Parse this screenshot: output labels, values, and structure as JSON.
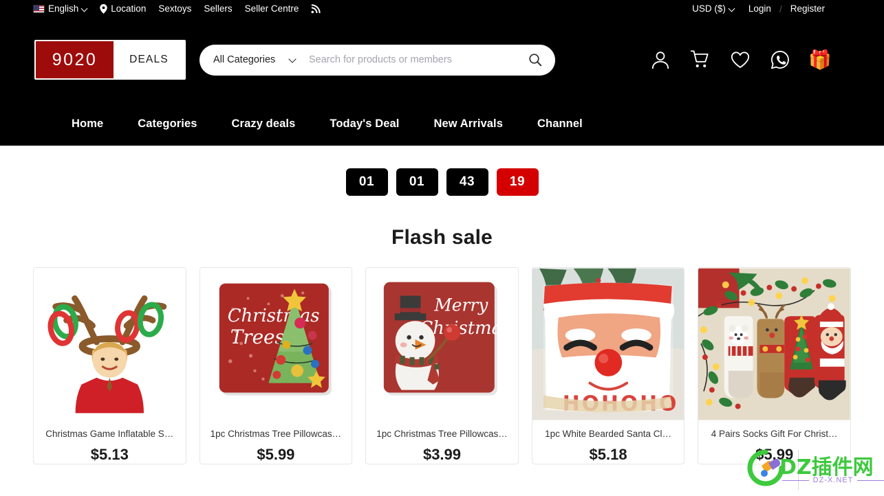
{
  "topbar": {
    "language": "English",
    "language_flag_icon": "us-flag-icon",
    "links": [
      "Location",
      "Sextoys",
      "Sellers",
      "Seller Centre"
    ],
    "rss_icon": "rss-icon",
    "currency": "USD ($)",
    "login": "Login",
    "separator": "/",
    "register": "Register"
  },
  "header": {
    "logo_primary": "9020",
    "logo_secondary": "DEALS",
    "search": {
      "category_label": "All Categories",
      "placeholder": "Search for products or members",
      "value": "",
      "search_icon": "search-icon"
    },
    "icons": [
      {
        "name": "account-icon",
        "label": "Account"
      },
      {
        "name": "cart-icon",
        "label": "Cart"
      },
      {
        "name": "wishlist-heart-icon",
        "label": "Wishlist"
      },
      {
        "name": "whatsapp-icon",
        "label": "WhatsApp"
      },
      {
        "name": "gift-icon",
        "label": "Gift",
        "glyph": "🎁"
      }
    ]
  },
  "nav": {
    "items": [
      "Home",
      "Categories",
      "Crazy deals",
      "Today's Deal",
      "New Arrivals",
      "Channel"
    ]
  },
  "flash_sale": {
    "title": "Flash sale",
    "countdown": [
      {
        "value": "01",
        "accent": false
      },
      {
        "value": "01",
        "accent": false
      },
      {
        "value": "43",
        "accent": false
      },
      {
        "value": "19",
        "accent": true
      }
    ],
    "accent_color": "#d40000"
  },
  "products": [
    {
      "title": "Christmas Game Inflatable S…",
      "price": "$5.13",
      "image": "reindeer-antler-ring-toss"
    },
    {
      "title": "1pc Christmas Tree Pillowcas…",
      "price": "$5.99",
      "image": "christmas-tree-pillow"
    },
    {
      "title": "1pc Christmas Tree Pillowcas…",
      "price": "$3.99",
      "image": "snowman-merry-christmas-pillow"
    },
    {
      "title": "1pc White Bearded Santa Cl…",
      "price": "$5.18",
      "image": "santa-face-pillow"
    },
    {
      "title": "4 Pairs Socks Gift For Christ…",
      "price": "$5.99",
      "image": "christmas-socks-set"
    }
  ],
  "watermark": {
    "text": "DZ插件网",
    "subtext": "DZ-X.NET",
    "color": "#3ec93e",
    "sub_color": "#9b7ede"
  }
}
